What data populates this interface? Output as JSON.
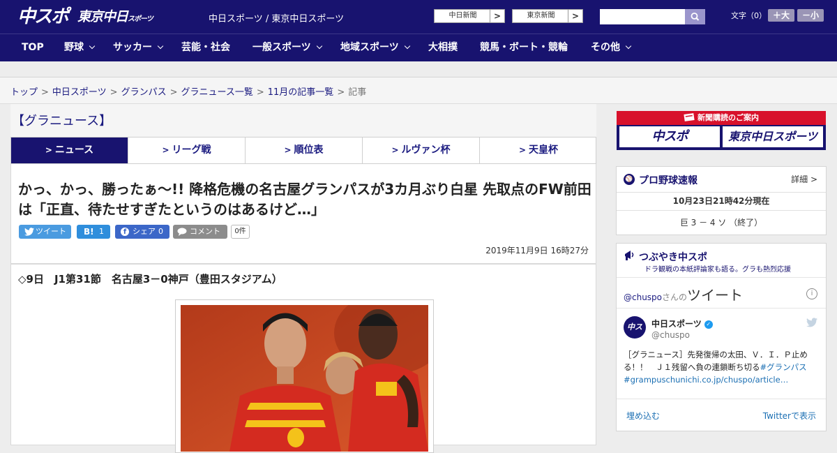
{
  "header": {
    "logo_chuspo": "中スポ",
    "logo_tokyo": "東京中日",
    "logo_tokyo_suffix": "スポーツ",
    "site_names": "中日スポーツ / 東京中日スポーツ",
    "btn_chunichi": "中日新聞",
    "btn_tokyo": "東京新聞",
    "arrow": ">",
    "search_placeholder": "",
    "font_size_label": "文字（0）",
    "size_up": "＋大",
    "size_down": "－小"
  },
  "nav": {
    "items": [
      {
        "label": "TOP"
      },
      {
        "label": "野球"
      },
      {
        "label": "サッカー"
      },
      {
        "label": "芸能・社会"
      },
      {
        "label": "一般スポーツ"
      },
      {
        "label": "地域スポーツ"
      },
      {
        "label": "大相撲"
      },
      {
        "label": "競馬・ボート・競輪"
      },
      {
        "label": "その他"
      }
    ]
  },
  "breadcrumb": {
    "sep": ">",
    "items": [
      "トップ",
      "中日スポーツ",
      "グランパス",
      "グラニュース一覧",
      "11月の記事一覧"
    ],
    "current": "記事"
  },
  "section": {
    "title": "【グラニュース】",
    "tabs": [
      "ニュース",
      "リーグ戦",
      "順位表",
      "ルヴァン杯",
      "天皇杯"
    ],
    "tab_marker": ">"
  },
  "article": {
    "headline": "かっ、かっ、勝ったぁ～!! 降格危機の名古屋グランパスが3カ月ぶり白星 先取点のFW前田は「正直、待たせすぎたというのはあるけど…」",
    "share": {
      "tweet": "ツイート",
      "hatena_mark": "B!",
      "hatena_count": "1",
      "fb": "シェア",
      "fb_count": "0",
      "comment": "コメント",
      "comment_count": "0件"
    },
    "date": "2019年11月9日 16時27分",
    "match_line": "◇9日　J1第31節　名古屋3－0神戸（豊田スタジアム）"
  },
  "sidebar": {
    "ad_title": "新聞購読のご案内",
    "ad_chuspo": "中スポ",
    "ad_tokyo": "東京中日スポーツ",
    "baseball": {
      "title": "プロ野球速報",
      "more": "詳細 >",
      "time": "10月23日21時42分現在",
      "score": "巨 3 － 4 ソ （終了）"
    },
    "tweets": {
      "title": "つぶやき中スポ",
      "subtitle": "ドラ観戦の本紙評論家も語る。グラも熱烈応援",
      "handle_link": "@chuspo",
      "handle_suffix": "さんの",
      "heading_big": "ツイート",
      "info": "i",
      "avatar": "中スポ",
      "name": "中日スポーツ",
      "verified": "✓",
      "handle": "@chuspo",
      "text_main": "［グラニュース］先発復帰の太田、Ｖ．Ｉ．Ｐ止める！！　Ｊ１残留へ負の連鎖断ち切る",
      "hashtag": "#グランパス",
      "link": "#grampuschunichi.co.jp/chuspo/article…",
      "embed": "埋め込む",
      "view": "Twitterで表示"
    }
  },
  "colors": {
    "brand_navy": "#18136f",
    "link_blue": "#1b1b80",
    "ad_red": "#d8112b",
    "tweet_blue": "#4a9be0",
    "fb_blue": "#3c67c8"
  }
}
